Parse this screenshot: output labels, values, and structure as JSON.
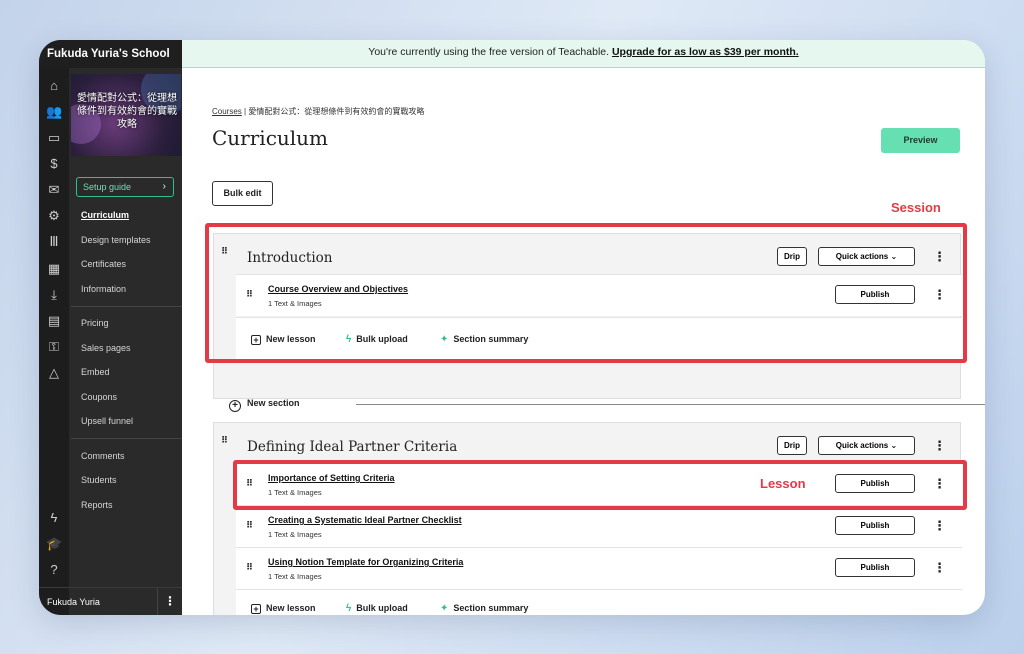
{
  "sidebar": {
    "school_name": "Fukuda Yuria's School",
    "course_thumb_title": "愛情配對公式：從理想條件到有效約會的實戰攻略",
    "setup_guide": "Setup guide",
    "groups": [
      [
        "Curriculum",
        "Design templates",
        "Certificates",
        "Information"
      ],
      [
        "Pricing",
        "Sales pages",
        "Embed",
        "Coupons",
        "Upsell funnel"
      ],
      [
        "Comments",
        "Students",
        "Reports"
      ]
    ],
    "active_item": "Curriculum",
    "rail_icons": [
      "home-icon",
      "users-icon",
      "devices-icon",
      "dollar-icon",
      "mail-icon",
      "gear-icon",
      "library-icon",
      "calendar-icon",
      "download-icon",
      "chat-icon",
      "key-icon",
      "shapes-icon",
      "bolt-icon",
      "graduation-cap-icon",
      "help-icon"
    ],
    "user_name": "Fukuda Yuria"
  },
  "banner": {
    "text": "You're currently using the free version of Teachable.",
    "link": "Upgrade for as low as $39 per month."
  },
  "breadcrumb": {
    "link": "Courses",
    "separator": "|",
    "current": "愛情配對公式：從理想條件到有效約會的實戰攻略"
  },
  "page_title": "Curriculum",
  "buttons": {
    "preview": "Preview",
    "bulk_edit": "Bulk edit",
    "drip": "Drip",
    "quick_actions": "Quick actions",
    "publish": "Publish",
    "new_lesson": "New lesson",
    "bulk_upload": "Bulk upload",
    "section_summary": "Section summary",
    "new_section": "New section"
  },
  "annotations": {
    "session": "Session",
    "lesson": "Lesson"
  },
  "sections": [
    {
      "title": "Introduction",
      "lessons": [
        {
          "title": "Course Overview and Objectives",
          "subtitle": "1 Text & Images"
        }
      ]
    },
    {
      "title": "Defining Ideal Partner Criteria",
      "lessons": [
        {
          "title": "Importance of Setting Criteria",
          "subtitle": "1 Text & Images"
        },
        {
          "title": "Creating a Systematic Ideal Partner Checklist",
          "subtitle": "1 Text & Images"
        },
        {
          "title": "Using Notion Template for Organizing Criteria",
          "subtitle": "1 Text & Images"
        }
      ]
    }
  ],
  "colors": {
    "accent": "#66dfb2",
    "annotation_red": "#e23b47",
    "sidebar_bg": "#2a2a2a",
    "banner_bg": "#e6f7ef"
  }
}
